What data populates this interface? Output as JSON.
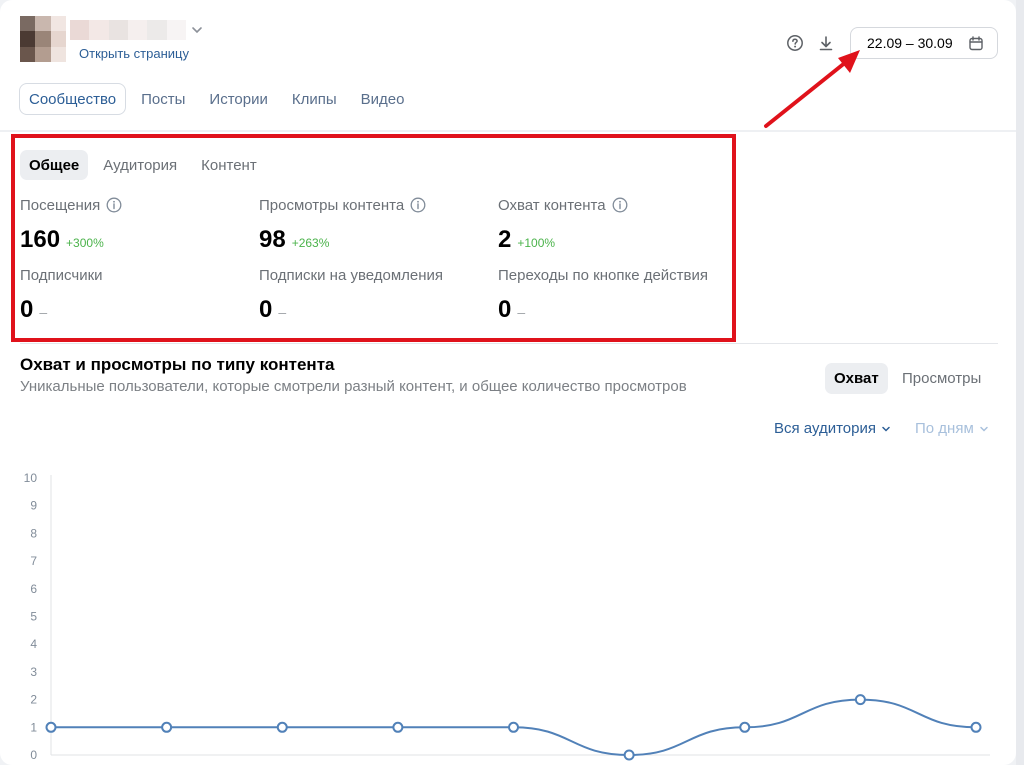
{
  "header": {
    "open_page_link": "Открыть страницу",
    "date_range": "22.09 – 30.09",
    "icons": [
      "help-icon",
      "download-icon",
      "calendar-icon"
    ]
  },
  "top_tabs": [
    {
      "label": "Сообщество",
      "active": true
    },
    {
      "label": "Посты",
      "active": false
    },
    {
      "label": "Истории",
      "active": false
    },
    {
      "label": "Клипы",
      "active": false
    },
    {
      "label": "Видео",
      "active": false
    }
  ],
  "sub_tabs": [
    {
      "label": "Общее",
      "active": true
    },
    {
      "label": "Аудитория",
      "active": false
    },
    {
      "label": "Контент",
      "active": false
    }
  ],
  "stats": [
    {
      "label": "Посещения",
      "value": "160",
      "change": "+300%",
      "info": true
    },
    {
      "label": "Просмотры контента",
      "value": "98",
      "change": "+263%",
      "info": true
    },
    {
      "label": "Охват контента",
      "value": "2",
      "change": "+100%",
      "info": true
    },
    {
      "label": "Подписчики",
      "value": "0",
      "change": "–",
      "info": false
    },
    {
      "label": "Подписки на уведомления",
      "value": "0",
      "change": "–",
      "info": false
    },
    {
      "label": "Переходы по кнопке действия",
      "value": "0",
      "change": "–",
      "info": false
    }
  ],
  "chart_section": {
    "title": "Охват и просмотры по типу контента",
    "subtitle": "Уникальные пользователи, которые смотрели разный контент, и общее количество просмотров",
    "segments": [
      {
        "label": "Охват",
        "active": true
      },
      {
        "label": "Просмотры",
        "active": false
      }
    ],
    "audience_filter": "Вся аудитория",
    "period_filter": "По дням"
  },
  "colors": {
    "accent": "#2c5e96",
    "positive": "#4bb34b",
    "highlight_box": "#e0121b",
    "line": "#5181b8"
  },
  "chart_data": {
    "type": "line",
    "title": "",
    "xlabel": "",
    "ylabel": "",
    "yticks": [
      0,
      1,
      2,
      3,
      4,
      5,
      6,
      7,
      8,
      9,
      10
    ],
    "ylim": [
      0,
      10
    ],
    "grid": false,
    "series": [
      {
        "values": [
          1,
          1,
          1,
          1,
          1,
          0,
          1,
          2,
          1
        ]
      }
    ]
  }
}
